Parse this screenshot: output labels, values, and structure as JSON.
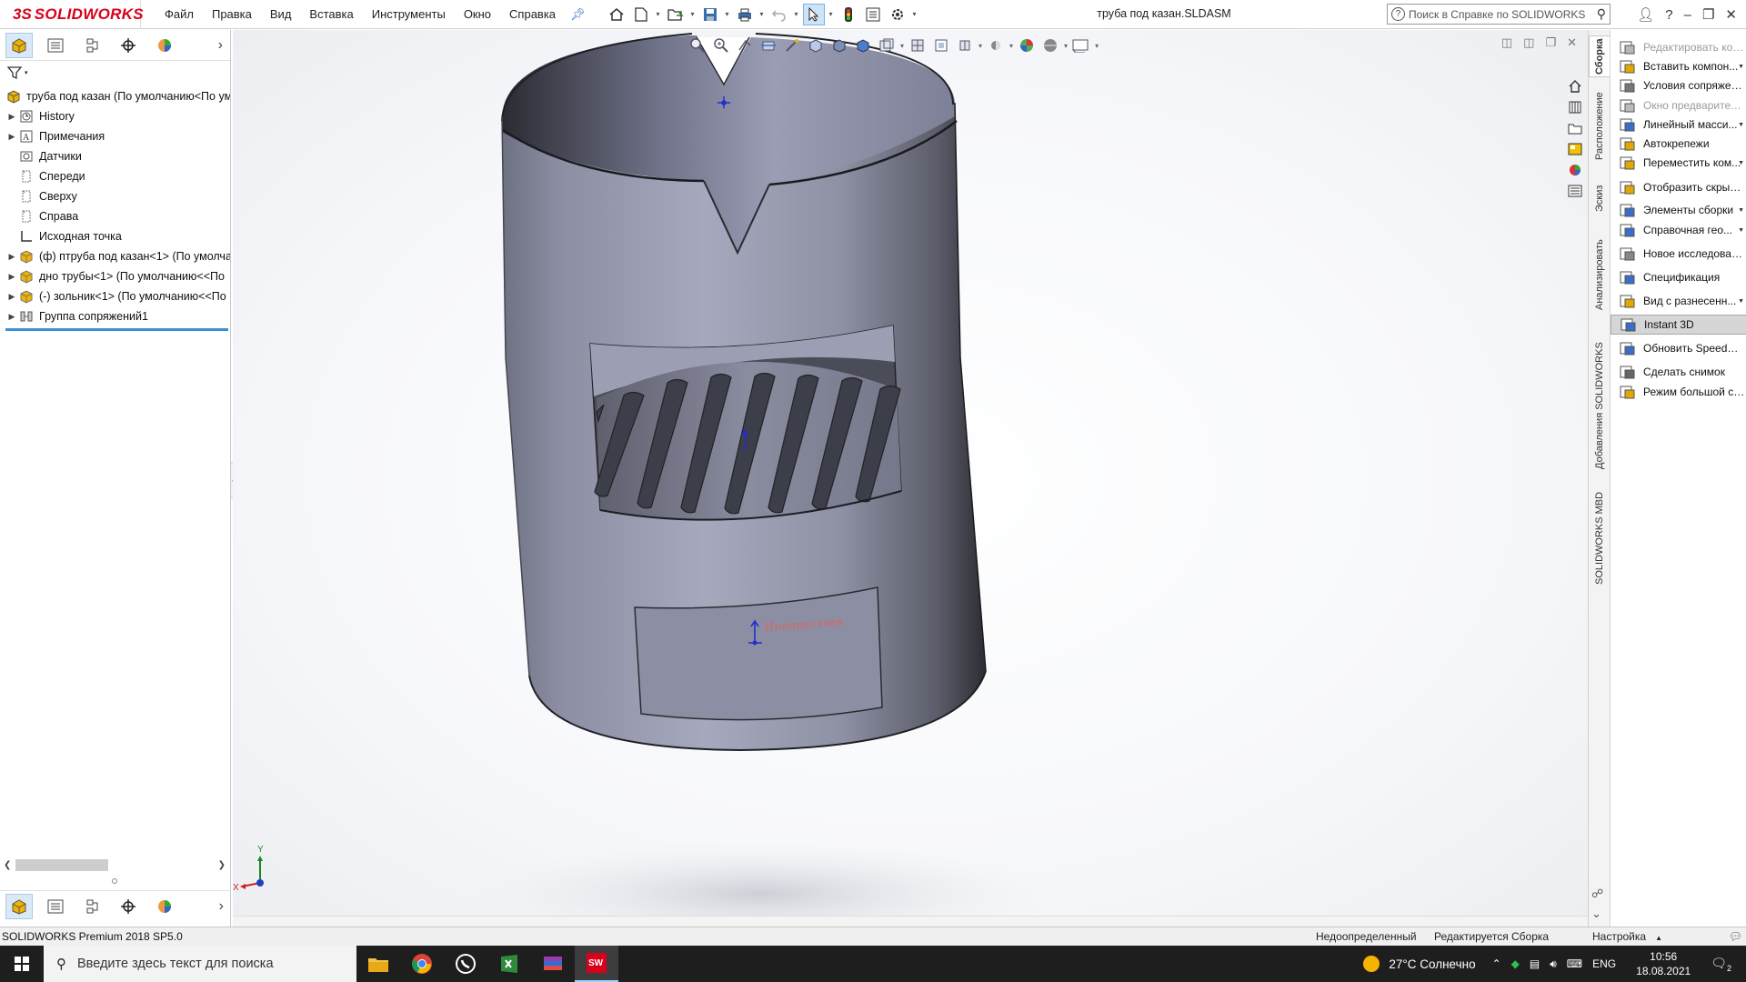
{
  "app": {
    "brand_prefix": "3S",
    "brand_name": "SOLIDWORKS",
    "document_title": "труба под казан.SLDASM"
  },
  "menu": [
    "Файл",
    "Правка",
    "Вид",
    "Вставка",
    "Инструменты",
    "Окно",
    "Справка"
  ],
  "help_search": {
    "placeholder": "Поиск в Справке по SOLIDWORKS"
  },
  "feature_tree": {
    "root": "труба под казан  (По умолчанию<По ум",
    "items": [
      {
        "label": "History",
        "icon": "history-icon",
        "expandable": true
      },
      {
        "label": "Примечания",
        "icon": "annotations-icon",
        "expandable": true
      },
      {
        "label": "Датчики",
        "icon": "sensors-icon",
        "expandable": false
      },
      {
        "label": "Спереди",
        "icon": "plane-icon",
        "expandable": false
      },
      {
        "label": "Сверху",
        "icon": "plane-icon",
        "expandable": false
      },
      {
        "label": "Справа",
        "icon": "plane-icon",
        "expandable": false
      },
      {
        "label": "Исходная точка",
        "icon": "origin-icon",
        "expandable": false
      },
      {
        "label": "(ф) птруба под казан<1> (По умолча",
        "icon": "part-icon",
        "expandable": true
      },
      {
        "label": "дно трубы<1> (По умолчанию<<По",
        "icon": "part-icon",
        "expandable": true
      },
      {
        "label": "(-) зольник<1> (По умолчанию<<По",
        "icon": "part-icon",
        "expandable": true
      },
      {
        "label": "Группа сопряжений1",
        "icon": "mates-icon",
        "expandable": true
      }
    ]
  },
  "model": {
    "sketch_text": "Нооnвоствея"
  },
  "task_tabs": [
    "Сборка",
    "Расположение",
    "Эскиз",
    "Анализировать",
    "Добавления SOLIDWORKS",
    "SOLIDWORKS MBD"
  ],
  "commands": [
    {
      "label": "Редактировать ком...",
      "icon": "edit-component-icon",
      "dropdown": false,
      "disabled": true,
      "highlighted": false
    },
    {
      "label": "Вставить компон...",
      "icon": "insert-component-icon",
      "dropdown": true,
      "disabled": false,
      "highlighted": false
    },
    {
      "label": "Условия сопряжения",
      "icon": "mate-icon",
      "dropdown": false,
      "disabled": false,
      "highlighted": false
    },
    {
      "label": "Окно предваритель...",
      "icon": "preview-window-icon",
      "dropdown": false,
      "disabled": true,
      "highlighted": false
    },
    {
      "label": "Линейный масси...",
      "icon": "linear-pattern-icon",
      "dropdown": true,
      "disabled": false,
      "highlighted": false
    },
    {
      "label": "Автокрепежи",
      "icon": "smart-fasteners-icon",
      "dropdown": false,
      "disabled": false,
      "highlighted": false
    },
    {
      "label": "Переместить ком...",
      "icon": "move-component-icon",
      "dropdown": true,
      "disabled": false,
      "highlighted": false
    },
    {
      "label": "Отобразить скрыты...",
      "icon": "show-hidden-icon",
      "dropdown": false,
      "disabled": false,
      "highlighted": false
    },
    {
      "label": "Элементы сборки",
      "icon": "assembly-features-icon",
      "dropdown": true,
      "disabled": false,
      "highlighted": false
    },
    {
      "label": "Справочная гео...",
      "icon": "reference-geometry-icon",
      "dropdown": true,
      "disabled": false,
      "highlighted": false
    },
    {
      "label": "Новое исследовани...",
      "icon": "new-motion-study-icon",
      "dropdown": false,
      "disabled": false,
      "highlighted": false
    },
    {
      "label": "Спецификация",
      "icon": "bom-icon",
      "dropdown": false,
      "disabled": false,
      "highlighted": false
    },
    {
      "label": "Вид с разнесенн...",
      "icon": "exploded-view-icon",
      "dropdown": true,
      "disabled": false,
      "highlighted": false
    },
    {
      "label": "Instant 3D",
      "icon": "instant-3d-icon",
      "dropdown": false,
      "disabled": false,
      "highlighted": true
    },
    {
      "label": "Обновить SpeedPak",
      "icon": "speedpak-icon",
      "dropdown": false,
      "disabled": false,
      "highlighted": false
    },
    {
      "label": "Сделать снимок",
      "icon": "snapshot-icon",
      "dropdown": false,
      "disabled": false,
      "highlighted": false
    },
    {
      "label": "Режим большой сб...",
      "icon": "large-assembly-icon",
      "dropdown": false,
      "disabled": false,
      "highlighted": false
    }
  ],
  "status": {
    "product": "SOLIDWORKS Premium 2018 SP5.0",
    "definition": "Недоопределенный",
    "editing": "Редактируется Сборка",
    "settings": "Настройка"
  },
  "taskbar": {
    "search_placeholder": "Введите здесь текст для поиска",
    "weather": "27°C  Солнечно",
    "lang": "ENG",
    "time": "10:56",
    "date": "18.08.2021",
    "notifications": "2"
  },
  "triad": {
    "x": "X",
    "y": "Y"
  }
}
